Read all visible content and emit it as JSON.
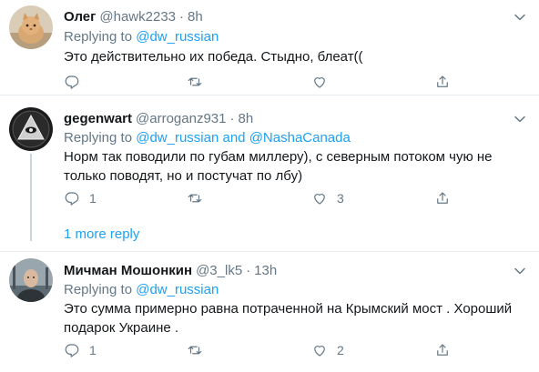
{
  "tweets": [
    {
      "name": "Олег",
      "handle": "@hawk2233",
      "dot": "·",
      "time": "8h",
      "replying_prefix": "Replying to ",
      "replying_to": "@dw_russian",
      "replying_joiner": "",
      "replying_to2": "",
      "text": "Это действительно их победа. Стыдно, блеат((",
      "replies": "",
      "retweets": "",
      "likes": ""
    },
    {
      "name": "gegenwart",
      "handle": "@arroganz931",
      "dot": "·",
      "time": "8h",
      "replying_prefix": "Replying to ",
      "replying_to": "@dw_russian",
      "replying_joiner": " and ",
      "replying_to2": "@NashaCanada",
      "text": "Норм так поводили по губам миллеру), с северным потоком чую не только поводят, но и постучат по лбу)",
      "replies": "1",
      "retweets": "",
      "likes": "3"
    },
    {
      "name": "Мичман Мошонкин",
      "handle": "@3_lk5",
      "dot": "·",
      "time": "13h",
      "replying_prefix": "Replying to ",
      "replying_to": "@dw_russian",
      "replying_joiner": "",
      "replying_to2": "",
      "text": "Это сумма примерно равна потраченной на Крымский мост . Хороший подарок Украине .",
      "replies": "1",
      "retweets": "",
      "likes": "2"
    }
  ],
  "more_replies": "1 more reply",
  "icons": {
    "reply": "reply-icon",
    "retweet": "retweet-icon",
    "like": "heart-icon",
    "share": "share-icon",
    "caret": "chevron-down-icon"
  },
  "colors": {
    "link": "#1da1f2",
    "muted": "#657786",
    "divider": "#e6ecf0"
  }
}
